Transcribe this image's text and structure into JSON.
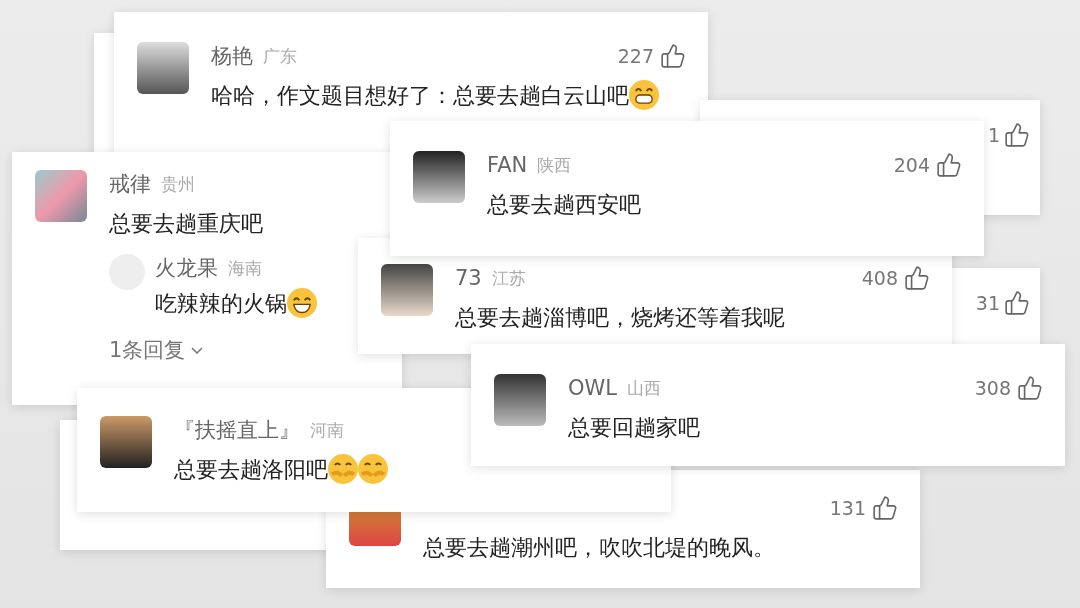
{
  "cards": [
    {
      "kind": "comment",
      "name": "杨艳",
      "region": "广东",
      "likes": "227",
      "text": "哈哈，作文题目想好了：总要去趟白云山吧"
    },
    {
      "kind": "blank"
    },
    {
      "kind": "partial",
      "likes": "1"
    },
    {
      "kind": "comment",
      "name": "FAN",
      "region": "陕西",
      "likes": "204",
      "text": "总要去趟西安吧"
    },
    {
      "kind": "comment",
      "name": "戒律",
      "region": "贵州",
      "text": "总要去趟重庆吧",
      "reply": {
        "name": "火龙果",
        "region": "海南",
        "text": "吃辣辣的火锅"
      },
      "replies_link": "1条回复"
    },
    {
      "kind": "comment",
      "name": "73",
      "region": "江苏",
      "likes": "408",
      "text": "总要去趟淄博吧，烧烤还等着我呢"
    },
    {
      "kind": "partial",
      "likes": "31"
    },
    {
      "kind": "comment",
      "name": "OWL",
      "region": "山西",
      "likes": "308",
      "text": "总要回趟家吧"
    },
    {
      "kind": "comment",
      "name": "『扶摇直上』",
      "region": "河南",
      "text": "总要去趟洛阳吧"
    },
    {
      "kind": "blank"
    },
    {
      "kind": "comment",
      "likes": "131",
      "text": "总要去趟潮州吧，吹吹北堤的晚风。"
    }
  ]
}
